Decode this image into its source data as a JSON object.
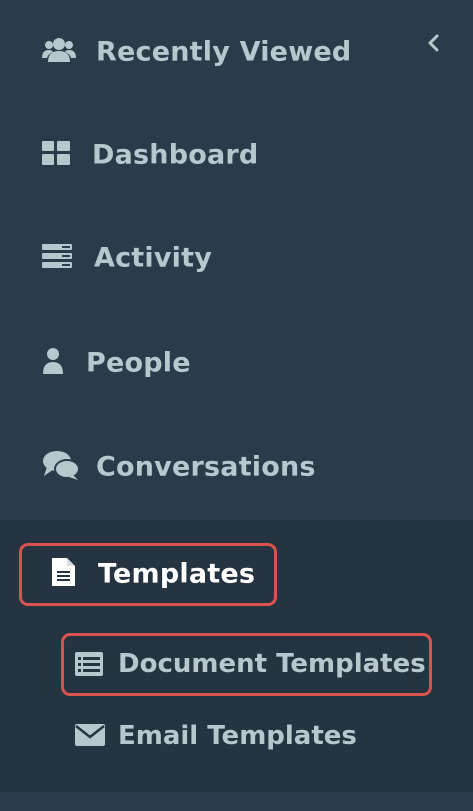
{
  "sidebar": {
    "items": [
      {
        "label": "Recently Viewed",
        "icon": "users-icon"
      },
      {
        "label": "Dashboard",
        "icon": "dashboard-icon"
      },
      {
        "label": "Activity",
        "icon": "activity-icon"
      },
      {
        "label": "People",
        "icon": "person-icon"
      },
      {
        "label": "Conversations",
        "icon": "comments-icon"
      },
      {
        "label": "Templates",
        "icon": "file-icon",
        "expanded": true
      }
    ],
    "templates_children": [
      {
        "label": "Document Templates",
        "icon": "list-alt-icon"
      },
      {
        "label": "Email Templates",
        "icon": "envelope-icon"
      }
    ],
    "collapse_icon": "chevron-left-icon"
  },
  "colors": {
    "sidebar_bg": "#2c3b49",
    "submenu_bg": "#263340",
    "text": "#b8c7ce",
    "active_text": "#ffffff",
    "highlight": "#d9534f"
  }
}
